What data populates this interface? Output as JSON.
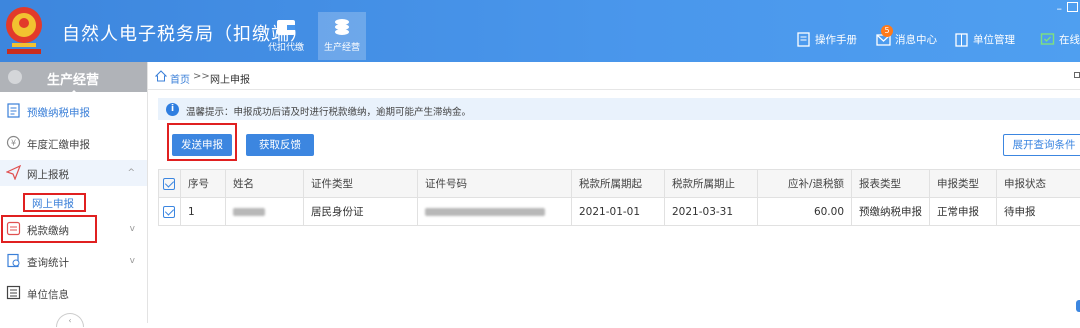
{
  "header": {
    "title": "自然人电子税务局（扣缴端）",
    "emblem": "national-emblem-icon",
    "tabs": [
      {
        "label": "代扣代缴",
        "icon": "wallet-icon"
      },
      {
        "label": "生产经营",
        "icon": "coins-icon"
      }
    ],
    "links": [
      {
        "label": "操作手册",
        "icon": "manual-icon"
      },
      {
        "label": "消息中心",
        "icon": "mail-icon",
        "badge": "5"
      },
      {
        "label": "单位管理",
        "icon": "building-icon"
      },
      {
        "label": "在线",
        "icon": "chat-icon"
      }
    ],
    "window_controls": {
      "minimize": "–"
    }
  },
  "sidebar": {
    "header": "生产经营",
    "items": [
      {
        "label": "预缴纳税申报",
        "icon": "form-icon"
      },
      {
        "label": "年度汇缴申报",
        "icon": "yuan-icon"
      },
      {
        "label": "网上报税",
        "icon": "send-icon",
        "chevron": "^"
      },
      {
        "label": "网上申报"
      },
      {
        "label": "税款缴纳",
        "icon": "tax-pay-icon",
        "chevron": "v"
      },
      {
        "label": "查询统计",
        "icon": "query-icon",
        "chevron": "v"
      },
      {
        "label": "单位信息",
        "icon": "list-icon"
      }
    ]
  },
  "breadcrumb": {
    "home": "首页",
    "separator": ">>",
    "current": "网上申报"
  },
  "notice": {
    "icon": "i",
    "text": "温馨提示：申报成功后请及时进行税款缴纳，逾期可能产生滞纳金。"
  },
  "toolbar": {
    "send": "发送申报",
    "feedback": "获取反馈",
    "expand": "展开查询条件"
  },
  "table": {
    "headers": [
      "序号",
      "姓名",
      "证件类型",
      "证件号码",
      "税款所属期起",
      "税款所属期止",
      "应补/退税额",
      "报表类型",
      "申报类型",
      "申报状态"
    ],
    "rows": [
      {
        "index": "1",
        "name": "",
        "id_type": "居民身份证",
        "id_number": "",
        "period_start": "2021-01-01",
        "period_end": "2021-03-31",
        "amount": "60.00",
        "report_type": "预缴纳税申报",
        "declare_type": "正常申报",
        "status": "待申报"
      }
    ]
  },
  "colors": {
    "header_blue": "#4a97ec",
    "accent": "#3c86e0",
    "highlight_red": "#e02020"
  }
}
